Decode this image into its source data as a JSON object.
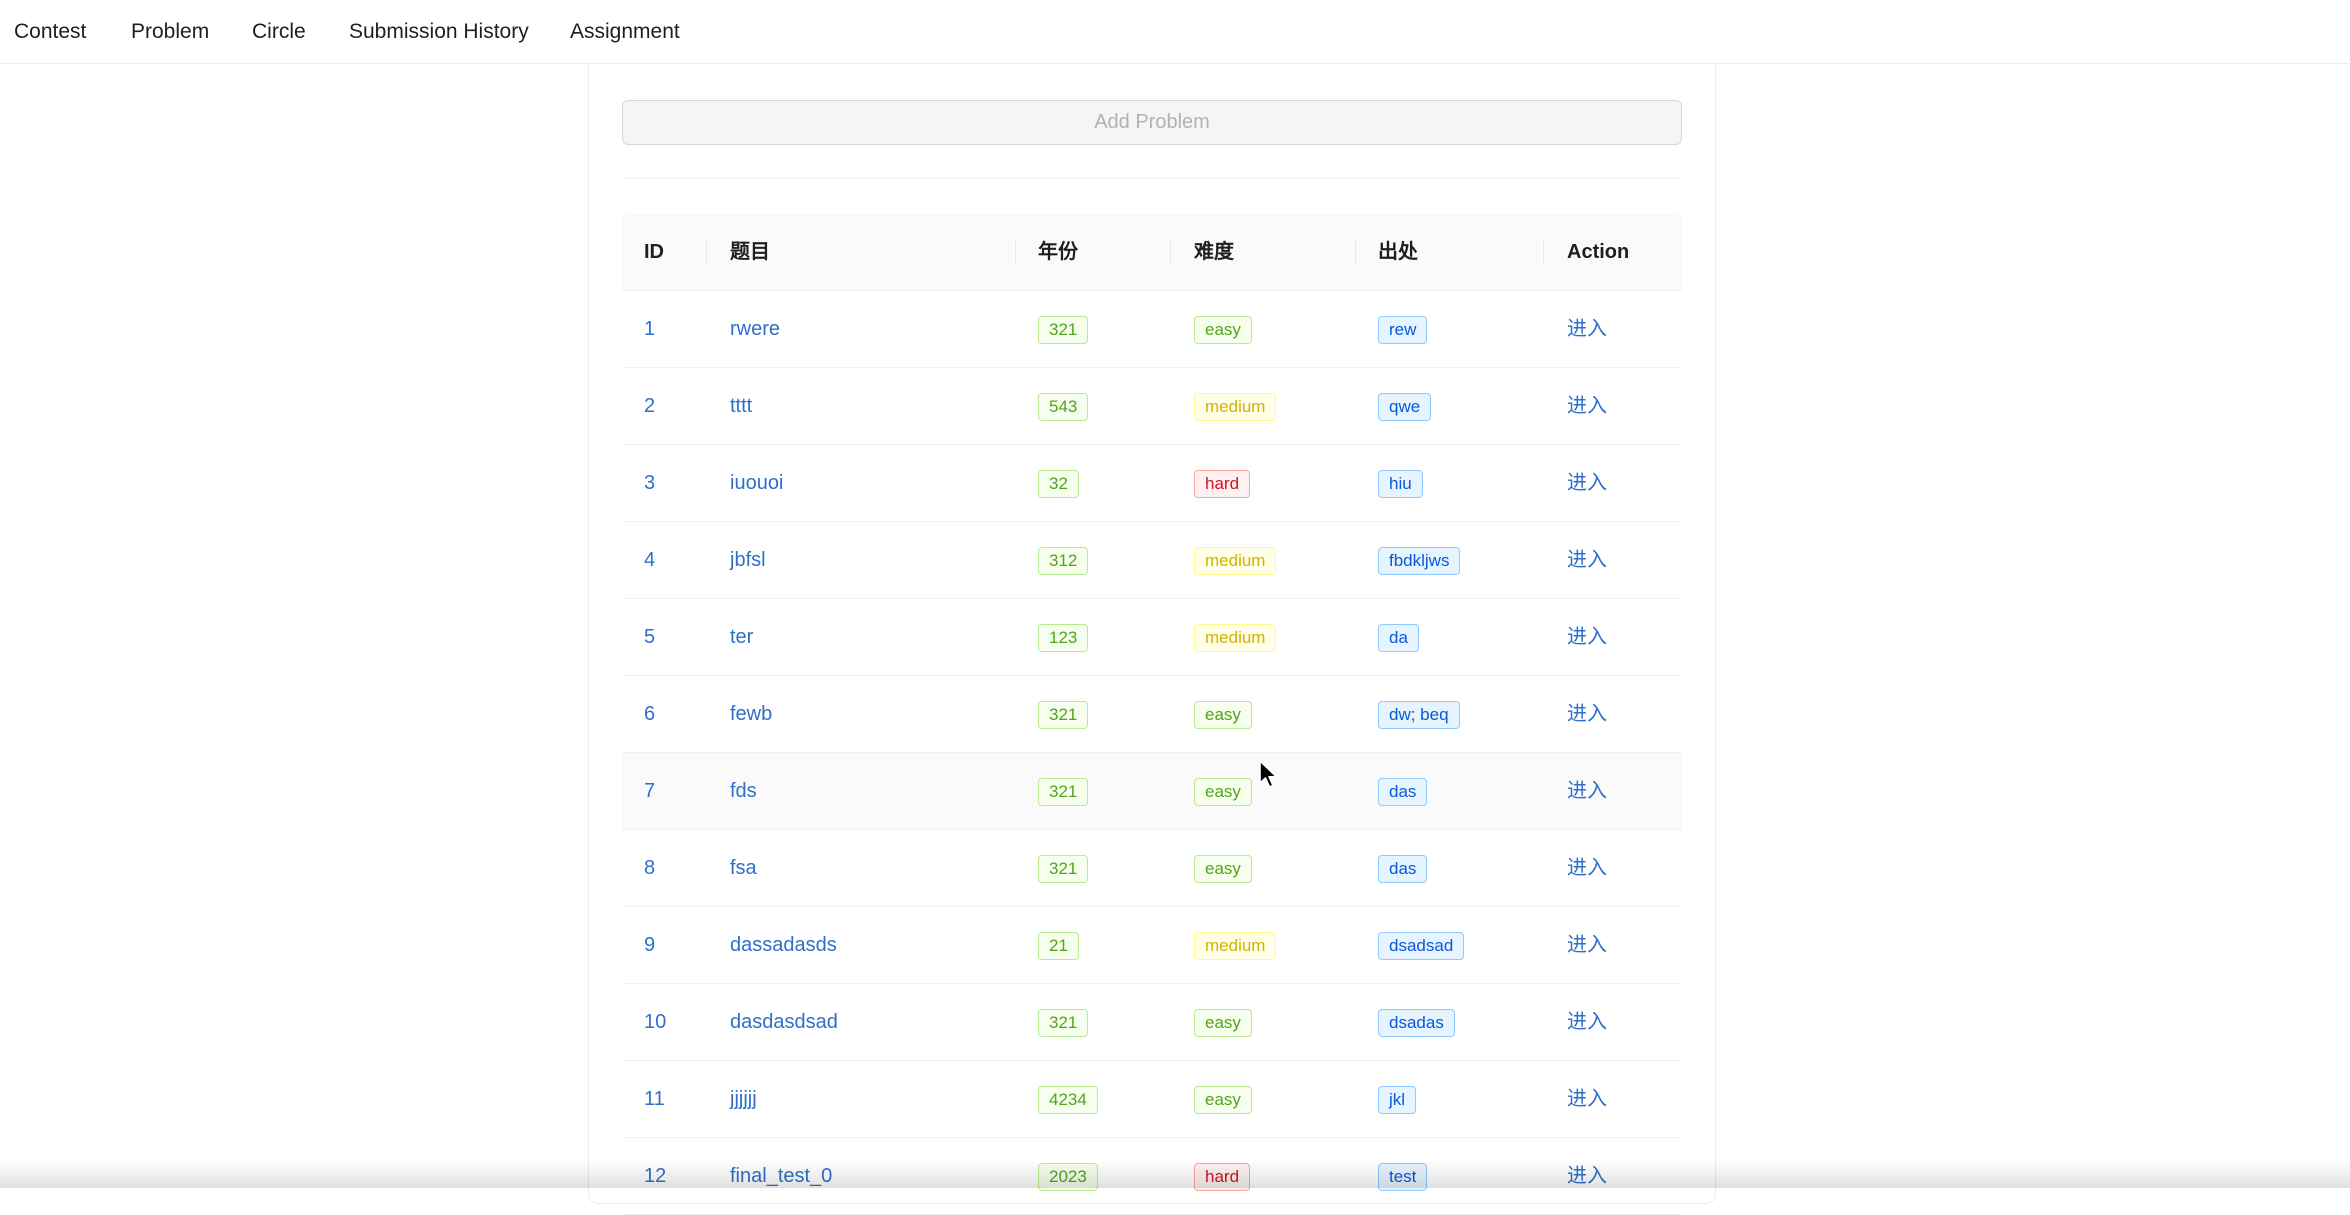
{
  "nav": {
    "items": [
      {
        "label": "Contest"
      },
      {
        "label": "Problem"
      },
      {
        "label": "Circle"
      },
      {
        "label": "Submission History"
      },
      {
        "label": "Assignment"
      }
    ]
  },
  "toolbar": {
    "add_problem_label": "Add Problem"
  },
  "table": {
    "columns": [
      "ID",
      "题目",
      "年份",
      "难度",
      "出处",
      "Action"
    ],
    "rows": [
      {
        "id": "1",
        "title": "rwere",
        "year": "321",
        "difficulty": "easy",
        "source": "rew",
        "action": "进入"
      },
      {
        "id": "2",
        "title": "tttt",
        "year": "543",
        "difficulty": "medium",
        "source": "qwe",
        "action": "进入"
      },
      {
        "id": "3",
        "title": "iuouoi",
        "year": "32",
        "difficulty": "hard",
        "source": "hiu",
        "action": "进入"
      },
      {
        "id": "4",
        "title": "jbfsl",
        "year": "312",
        "difficulty": "medium",
        "source": "fbdkljws",
        "action": "进入"
      },
      {
        "id": "5",
        "title": "ter",
        "year": "123",
        "difficulty": "medium",
        "source": "da",
        "action": "进入"
      },
      {
        "id": "6",
        "title": "fewb",
        "year": "321",
        "difficulty": "easy",
        "source": "dw; beq",
        "action": "进入"
      },
      {
        "id": "7",
        "title": "fds",
        "year": "321",
        "difficulty": "easy",
        "source": "das",
        "action": "进入"
      },
      {
        "id": "8",
        "title": "fsa",
        "year": "321",
        "difficulty": "easy",
        "source": "das",
        "action": "进入"
      },
      {
        "id": "9",
        "title": "dassadasds",
        "year": "21",
        "difficulty": "medium",
        "source": "dsadsad",
        "action": "进入"
      },
      {
        "id": "10",
        "title": "dasdasdsad",
        "year": "321",
        "difficulty": "easy",
        "source": "dsadas",
        "action": "进入"
      },
      {
        "id": "11",
        "title": "jjjjjj",
        "year": "4234",
        "difficulty": "easy",
        "source": "jkl",
        "action": "进入"
      },
      {
        "id": "12",
        "title": "final_test_0",
        "year": "2023",
        "difficulty": "hard",
        "source": "test",
        "action": "进入"
      }
    ]
  },
  "colors": {
    "link": "#2f6fcb",
    "easy": "#52a41a",
    "medium": "#d4b106",
    "hard": "#cf1322",
    "source": "#0958d9"
  },
  "icons": {
    "cursor": "mouse-pointer-icon"
  }
}
